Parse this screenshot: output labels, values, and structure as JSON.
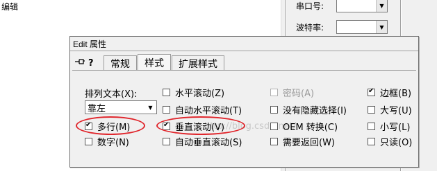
{
  "editor": {
    "label": "编辑"
  },
  "right_panel": {
    "port_label": "串口号:",
    "baud_label": "波特率:"
  },
  "dialog": {
    "title": "Edit 属性",
    "tabs": [
      {
        "label": "常规",
        "active": false
      },
      {
        "label": "样式",
        "active": true
      },
      {
        "label": "扩展样式",
        "active": false
      }
    ],
    "align": {
      "label": "排列文本(X):",
      "value": "靠左"
    },
    "checkboxes": {
      "multiline": {
        "label": "多行(M)",
        "checked": true,
        "disabled": false
      },
      "number": {
        "label": "数字(N)",
        "checked": false,
        "disabled": false
      },
      "hscroll": {
        "label": "水平滚动(Z)",
        "checked": false,
        "disabled": false
      },
      "auto_hscroll": {
        "label": "自动水平滚动(T)",
        "checked": false,
        "disabled": false
      },
      "vscroll": {
        "label": "垂直滚动(V)",
        "checked": true,
        "disabled": false
      },
      "auto_vscroll": {
        "label": "自动垂直滚动(S)",
        "checked": false,
        "disabled": false
      },
      "password": {
        "label": "密码(A)",
        "checked": false,
        "disabled": true
      },
      "no_hide_sel": {
        "label": "没有隐藏选择(I)",
        "checked": false,
        "disabled": false
      },
      "oem_convert": {
        "label": "OEM 转换(C)",
        "checked": false,
        "disabled": false
      },
      "want_return": {
        "label": "需要返回(W)",
        "checked": false,
        "disabled": false
      },
      "border": {
        "label": "边框(B)",
        "checked": true,
        "disabled": false
      },
      "uppercase": {
        "label": "大写(U)",
        "checked": false,
        "disabled": false
      },
      "lowercase": {
        "label": "小写(L)",
        "checked": false,
        "disabled": false
      },
      "readonly": {
        "label": "只读(O)",
        "checked": false,
        "disabled": false
      }
    },
    "watermark": "http://blog.csdn.net/"
  },
  "icons": {
    "pin": "pin-icon",
    "help": "help-icon"
  },
  "colors": {
    "highlight_ellipse": "#e0262c"
  }
}
